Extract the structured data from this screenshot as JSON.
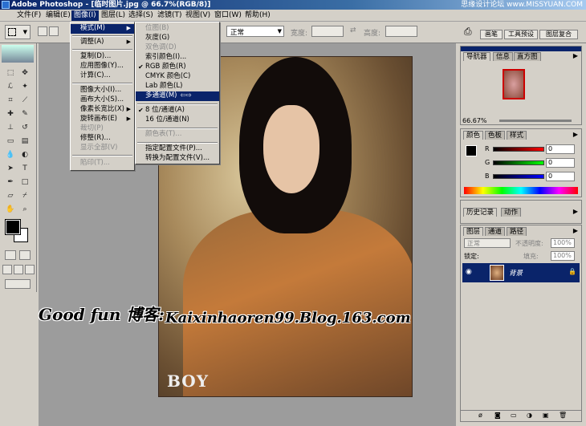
{
  "app": {
    "title": "Adobe Photoshop - [临时图片.jpg @ 66.7%(RGB/8)]",
    "watermark": "思缘设计论坛 www.MISSYUAN.COM"
  },
  "menubar": [
    "文件(F)",
    "编辑(E)",
    "图像(I)",
    "图层(L)",
    "选择(S)",
    "滤镜(T)",
    "视图(V)",
    "窗口(W)",
    "帮助(H)"
  ],
  "options": {
    "mode_value": "正常",
    "width_label": "宽度:",
    "height_label": "高度:",
    "buttons": [
      "画笔",
      "工具预设",
      "图层复合"
    ]
  },
  "image_menu": {
    "items": [
      {
        "label": "模式(M)",
        "submenu": true,
        "highlighted": true
      },
      {
        "label": "调整(A)",
        "submenu": true
      },
      {
        "label": "复制(D)..."
      },
      {
        "label": "应用图像(Y)..."
      },
      {
        "label": "计算(C)..."
      },
      {
        "label": "图像大小(I)..."
      },
      {
        "label": "画布大小(S)..."
      },
      {
        "label": "像素长宽比(X)",
        "submenu": true
      },
      {
        "label": "旋转画布(E)",
        "submenu": true
      },
      {
        "label": "裁切(P)",
        "disabled": true
      },
      {
        "label": "修整(R)..."
      },
      {
        "label": "显示全部(V)",
        "disabled": true
      },
      {
        "label": "陷印(T)...",
        "disabled": true
      }
    ]
  },
  "mode_menu": {
    "items": [
      {
        "label": "位图(B)",
        "disabled": true
      },
      {
        "label": "灰度(G)"
      },
      {
        "label": "双色调(D)",
        "disabled": true
      },
      {
        "label": "索引颜色(I)..."
      },
      {
        "label": "RGB 颜色(R)",
        "checked": true
      },
      {
        "label": "CMYK 颜色(C)"
      },
      {
        "label": "Lab 颜色(L)"
      },
      {
        "label": "多通道(M)",
        "highlighted": true
      },
      {
        "label": "8 位/通道(A)",
        "checked": true
      },
      {
        "label": "16 位/通道(N)"
      },
      {
        "label": "颜色表(T)...",
        "disabled": true
      },
      {
        "label": "指定配置文件(P)..."
      },
      {
        "label": "转换为配置文件(V)..."
      }
    ]
  },
  "navigator": {
    "tabs": [
      "导航器",
      "信息",
      "直方图"
    ],
    "zoom": "66.67%"
  },
  "color_panel": {
    "tabs": [
      "颜色",
      "色板",
      "样式"
    ],
    "channels": [
      {
        "name": "R",
        "value": "0",
        "color": "#c00000"
      },
      {
        "name": "G",
        "value": "0",
        "color": "#008000"
      },
      {
        "name": "B",
        "value": "0",
        "color": "#0000c0"
      }
    ]
  },
  "history": {
    "tabs": [
      "历史记录",
      "动作"
    ]
  },
  "layers": {
    "tabs": [
      "图层",
      "通道",
      "路径"
    ],
    "blend": "正常",
    "opacity_label": "不透明度:",
    "opacity": "100%",
    "lock_label": "锁定:",
    "fill_label": "填充:",
    "fill": "100%",
    "layer_name": "背景"
  },
  "overlay": {
    "left_text": "Good fun 博客:",
    "right_text": "Kaixinhaoren99.Blog.163.com",
    "logo": "BOY"
  }
}
